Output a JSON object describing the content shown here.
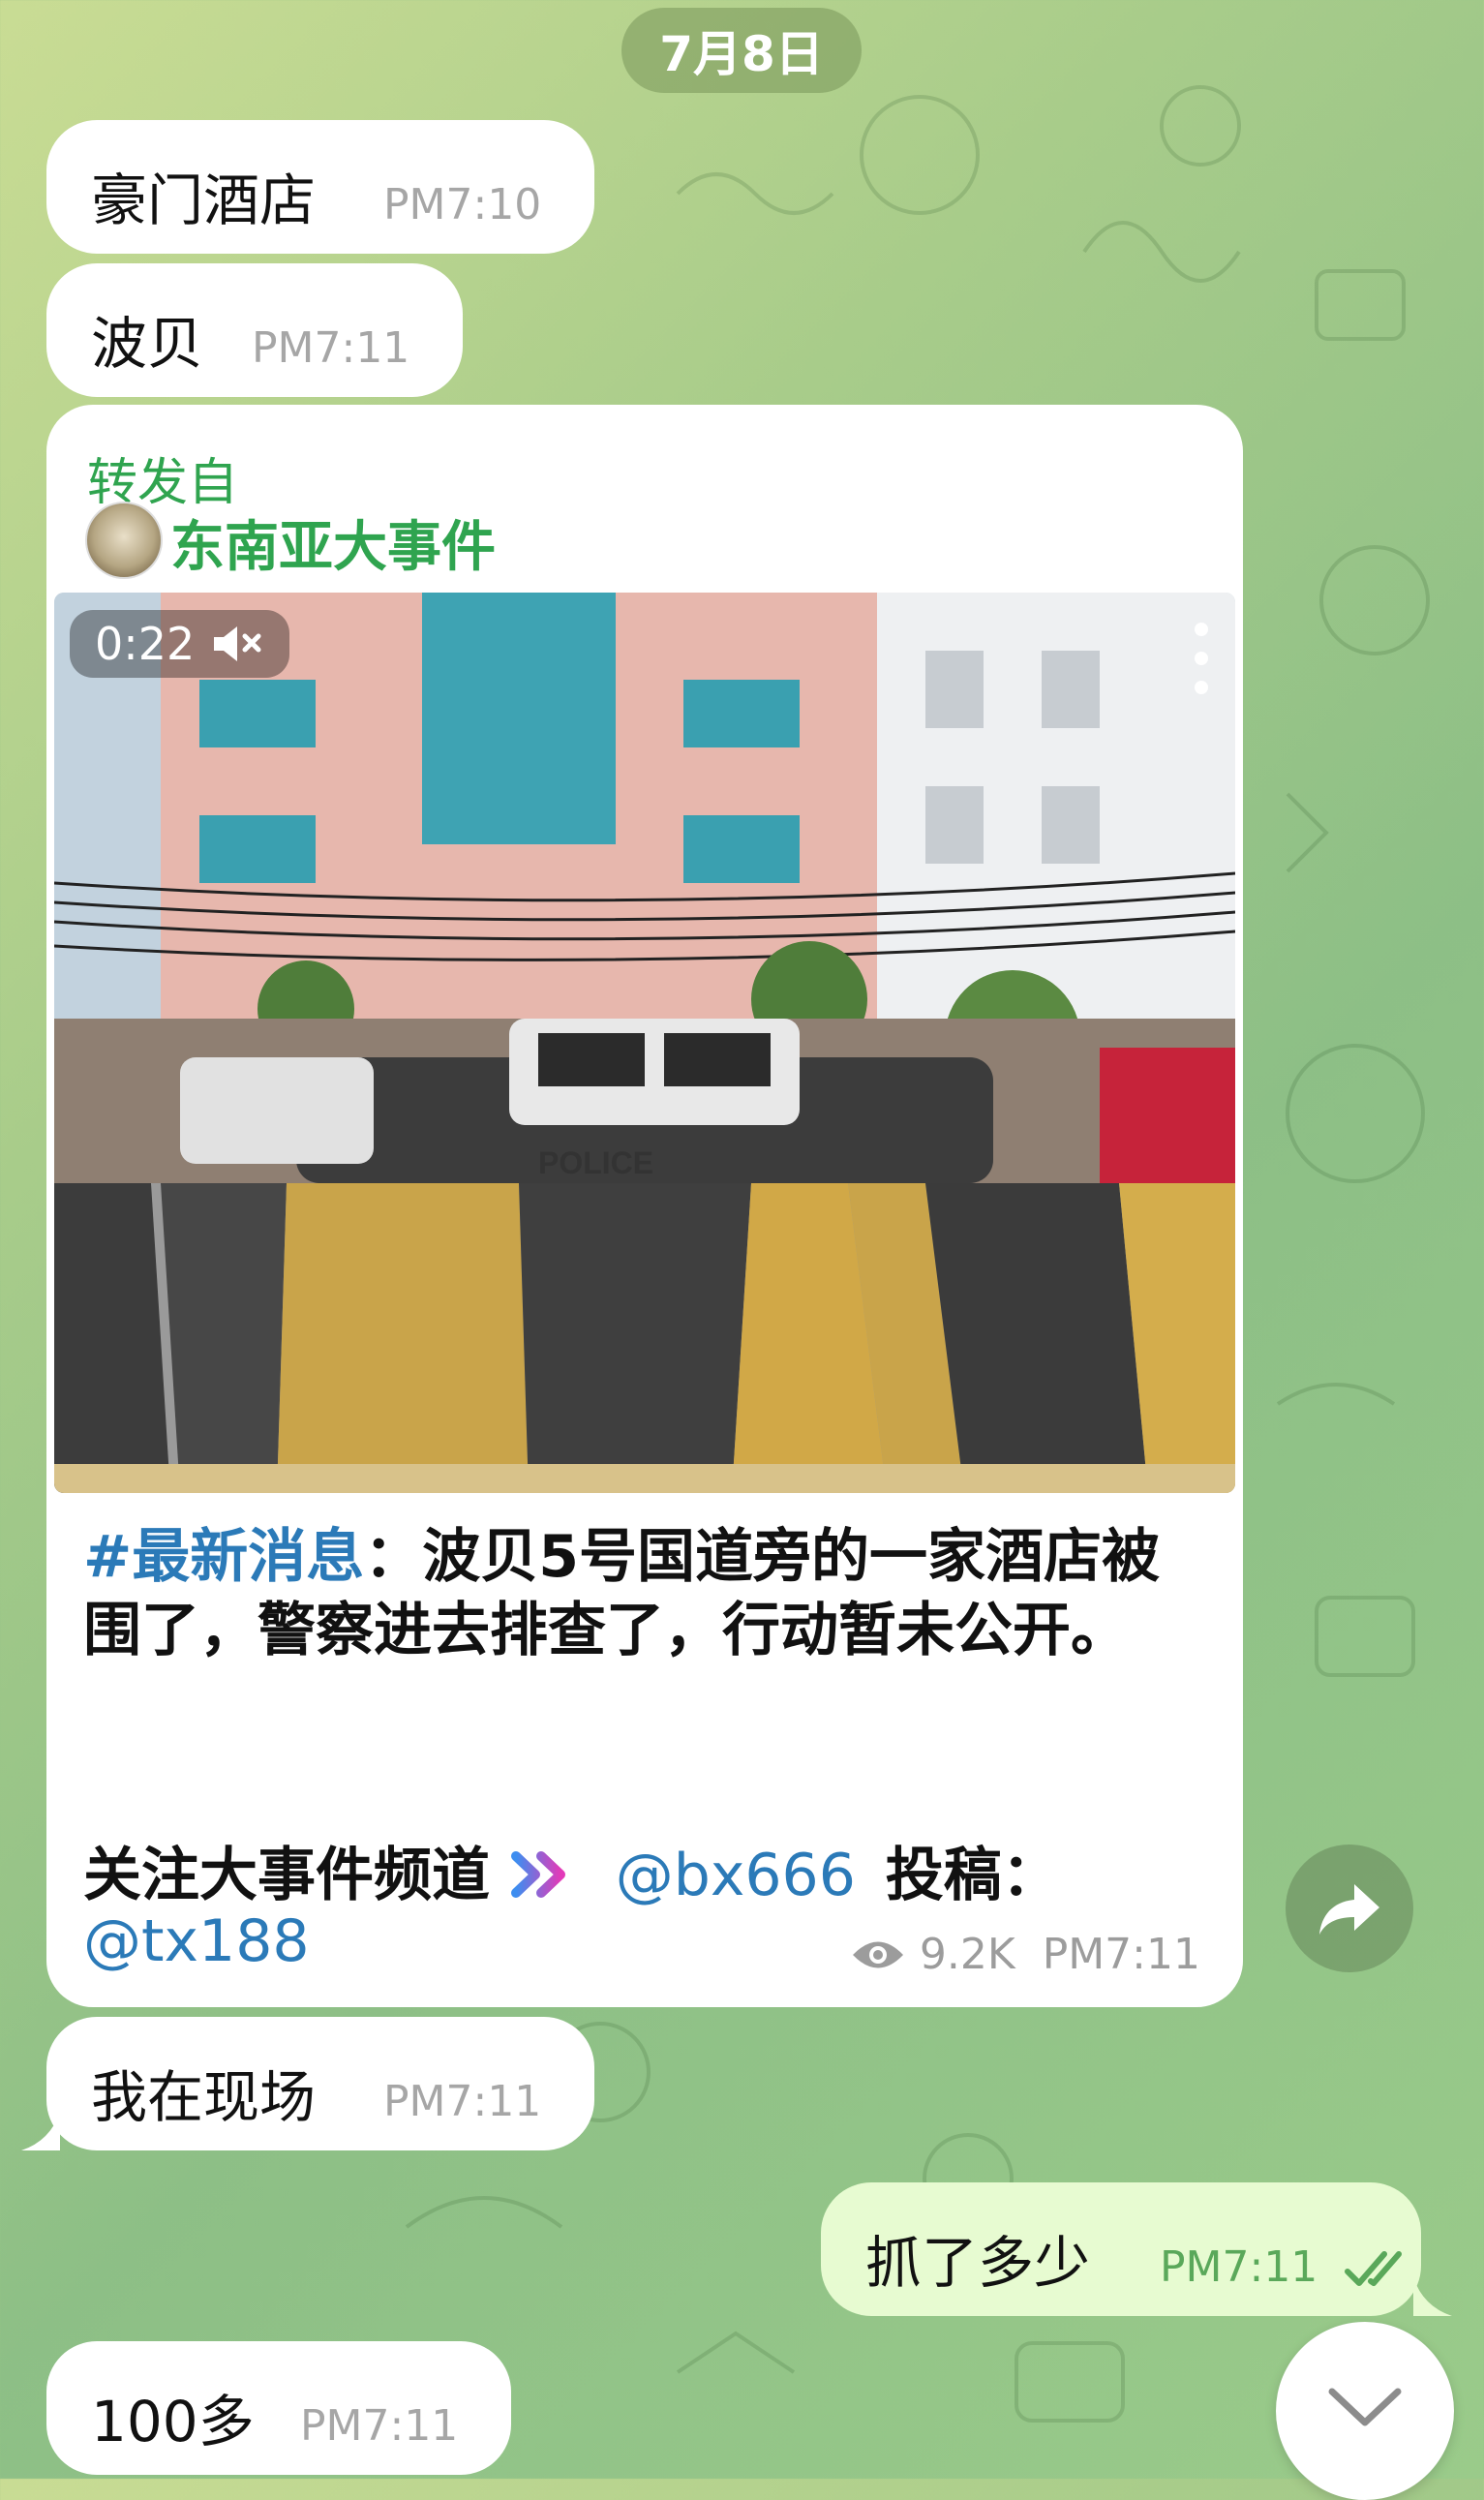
{
  "date_separator": "7月8日",
  "messages": [
    {
      "text": "豪门酒店",
      "time": "PM7:10"
    },
    {
      "text": "波贝",
      "time": "PM7:11"
    },
    {
      "text": "我在现场",
      "time": "PM7:11"
    },
    {
      "text": "抓了多少",
      "time": "PM7:11"
    },
    {
      "text": "100多",
      "time": "PM7:11"
    }
  ],
  "forwarded_post": {
    "forward_label": "转发自",
    "channel_name": "东南亚大事件",
    "video_duration": "0:22",
    "hashtag": "#最新消息",
    "body": "：波贝5号国道旁的一家酒店被围了，警察进去排查了，行动暂未公开。",
    "follow_text": "关注大事件频道",
    "handle1": "@bx666",
    "submit_text": "投稿：",
    "handle2": "@tx188",
    "views": "9.2K",
    "time": "PM7:11"
  },
  "icons": {
    "mute": "speaker-muted-icon",
    "menu": "three-dots-vertical-icon",
    "views": "eye-icon",
    "share": "share-arrow-icon",
    "read": "double-check-icon",
    "scroll": "chevron-down-icon",
    "arrows": "double-chevron-right-icon"
  },
  "colors": {
    "channel_green": "#2fa44f",
    "link_blue": "#2b7ab8",
    "outgoing_bubble": "#e7fbd1"
  }
}
